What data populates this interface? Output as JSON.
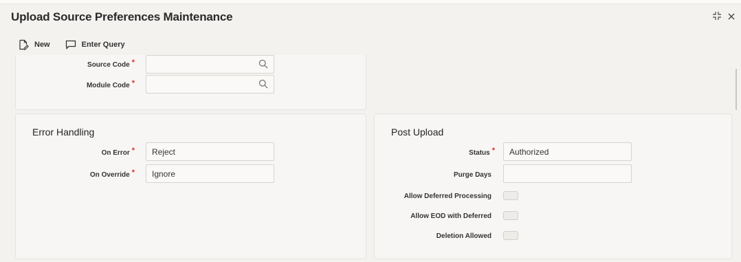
{
  "window": {
    "title": "Upload Source Preferences Maintenance"
  },
  "toolbar": {
    "new_label": "New",
    "enter_query_label": "Enter Query"
  },
  "main": {
    "source_code_label": "Source Code",
    "module_code_label": "Module Code",
    "required_mark": "*",
    "source_code_value": "",
    "module_code_value": ""
  },
  "error_handling": {
    "heading": "Error Handling",
    "on_error_label": "On Error",
    "on_error_value": "Reject",
    "on_override_label": "On Override",
    "on_override_value": "Ignore"
  },
  "post_upload": {
    "heading": "Post Upload",
    "status_label": "Status",
    "status_value": "Authorized",
    "purge_days_label": "Purge Days",
    "purge_days_value": "",
    "allow_deferred_label": "Allow Deferred Processing",
    "allow_eod_label": "Allow EOD with Deferred",
    "deletion_allowed_label": "Deletion Allowed"
  },
  "icons": {
    "new": "new-document-icon",
    "enter_query": "comment-icon",
    "search": "search-icon",
    "expand": "expand-icon",
    "close": "close-icon"
  },
  "colors": {
    "required": "#d0312d",
    "panel_bg": "#f7f6f4",
    "page_bg": "#f4f2ef"
  }
}
